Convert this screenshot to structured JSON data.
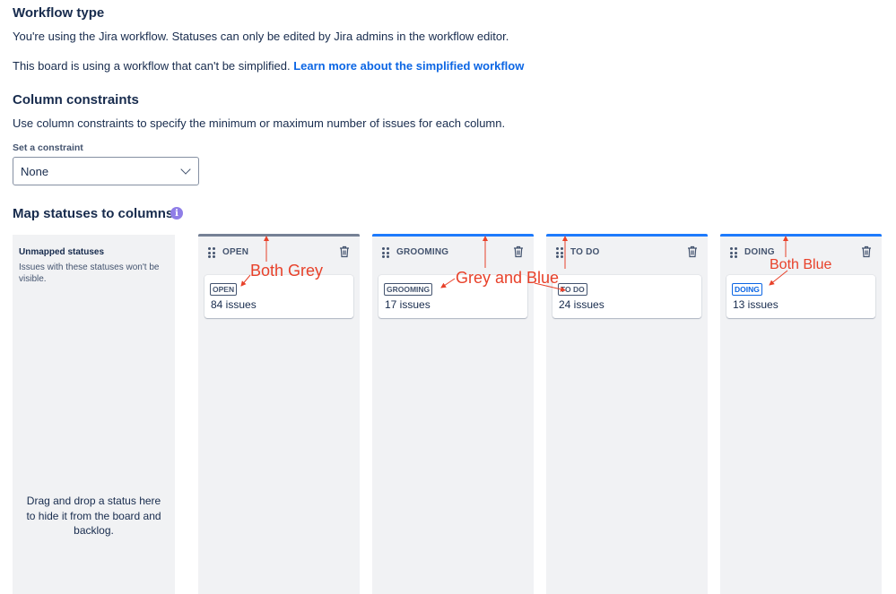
{
  "workflow": {
    "heading": "Workflow type",
    "line1": "You're using the Jira workflow. Statuses can only be edited by Jira admins in the workflow editor.",
    "line2": "This board is using a workflow that can't be simplified.",
    "link": "Learn more about the simplified workflow"
  },
  "constraints": {
    "heading": "Column constraints",
    "description": "Use column constraints to specify the minimum or maximum number of issues for each column.",
    "select_label": "Set a constraint",
    "select_value": "None"
  },
  "map": {
    "heading": "Map statuses to columns",
    "info_glyph": "i",
    "unmapped": {
      "title": "Unmapped statuses",
      "description": "Issues with these statuses won't be visible.",
      "drop_hint": "Drag and drop a status here to hide it from the board and backlog."
    },
    "columns": [
      {
        "name": "OPEN",
        "bar_color": "#758195",
        "status": "OPEN",
        "status_color": "#44546f",
        "status_border": "#44546f",
        "issues": "84 issues"
      },
      {
        "name": "GROOMING",
        "bar_color": "#1d7afc",
        "status": "GROOMING",
        "status_color": "#44546f",
        "status_border": "#44546f",
        "issues": "17 issues"
      },
      {
        "name": "TO DO",
        "bar_color": "#1d7afc",
        "status": "TO DO",
        "status_color": "#44546f",
        "status_border": "#44546f",
        "issues": "24 issues"
      },
      {
        "name": "DOING",
        "bar_color": "#1d7afc",
        "status": "DOING",
        "status_color": "#0c66e4",
        "status_border": "#0c66e4",
        "issues": "13 issues"
      }
    ]
  },
  "annotations": {
    "open": "Both Grey",
    "grooming": "Grey and Blue",
    "doing": "Both Blue",
    "color": "#e8412a"
  }
}
